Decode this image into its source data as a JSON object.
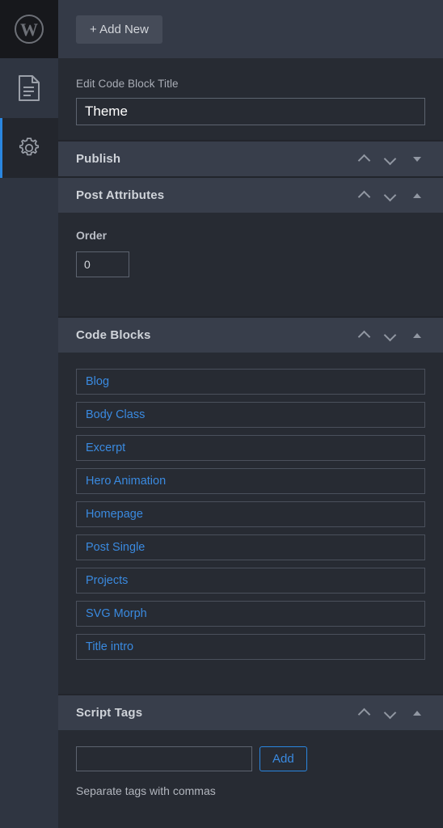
{
  "rail": {
    "logo": {
      "name": "wordpress-logo",
      "glyph": "W"
    },
    "items": [
      {
        "id": "document",
        "icon": "document-icon",
        "active": false
      },
      {
        "id": "settings",
        "icon": "gear-icon",
        "active": true
      }
    ]
  },
  "toolbar": {
    "add_new_label": "+ Add New"
  },
  "title_field": {
    "label": "Edit Code Block Title",
    "value": "Theme"
  },
  "panels": {
    "publish": {
      "title": "Publish",
      "collapsed": true,
      "toggle_glyph": "▼"
    },
    "post_attributes": {
      "title": "Post Attributes",
      "collapsed": false,
      "toggle_glyph": "▲",
      "order": {
        "label": "Order",
        "value": "0"
      }
    },
    "code_blocks": {
      "title": "Code Blocks",
      "collapsed": false,
      "toggle_glyph": "▲",
      "items": [
        {
          "label": "Blog"
        },
        {
          "label": "Body Class"
        },
        {
          "label": "Excerpt"
        },
        {
          "label": "Hero Animation"
        },
        {
          "label": "Homepage"
        },
        {
          "label": "Post Single"
        },
        {
          "label": "Projects"
        },
        {
          "label": "SVG Morph"
        },
        {
          "label": "Title intro"
        }
      ]
    },
    "script_tags": {
      "title": "Script Tags",
      "collapsed": false,
      "toggle_glyph": "▲",
      "input_value": "",
      "input_placeholder": "",
      "add_label": "Add",
      "hint": "Separate tags with commas"
    }
  },
  "controls": {
    "move_up_label": "Move up",
    "move_down_label": "Move down",
    "toggle_label": "Toggle panel"
  },
  "colors": {
    "accent_blue": "#2a86e0",
    "link_blue": "#3a8ae0",
    "panel_header": "#383e4b",
    "page_bg": "#272b33",
    "rail_bg": "#2f3541",
    "logo_bg": "#17181c"
  }
}
